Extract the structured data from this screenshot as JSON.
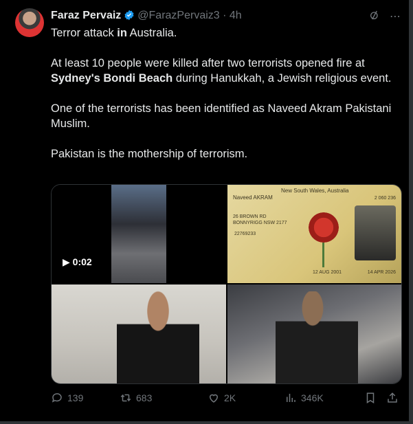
{
  "author": {
    "name": "Faraz Pervaiz",
    "handle": "@FarazPervaiz3",
    "separator": "·",
    "time": "4h"
  },
  "tweet": {
    "line1_prefix": "Terror attack ",
    "line1_bold": "in",
    "line1_suffix": " Australia.",
    "p2_a": "At least 10 people were killed after two terrorists opened fire at ",
    "p2_sydney": "Sydney's",
    "p2_space": " ",
    "p2_bondi": "Bondi Beach",
    "p2_b": " during Hanukkah, a Jewish religious event.",
    "p3": "One of the terrorists has been identified as Naveed Akram Pakistani Muslim.",
    "p4": "Pakistan is the mothership of terrorism."
  },
  "media": {
    "video_time": "0:02",
    "license": {
      "state": "New South Wales, Australia",
      "name": "Naveed AKRAM",
      "address": "26 BROWN RD\nBONNYRIGG NSW 2177",
      "licence_no": "22769233",
      "card_no": "2 060 236",
      "dob": "12 AUG 2001",
      "expiry": "14 APR 2026"
    }
  },
  "actions": {
    "replies": "139",
    "retweets": "683",
    "likes": "2K",
    "views": "346K"
  },
  "colors": {
    "background": "#000000",
    "text": "#e7e9ea",
    "muted": "#71767b",
    "verified": "#1d9bf0"
  }
}
